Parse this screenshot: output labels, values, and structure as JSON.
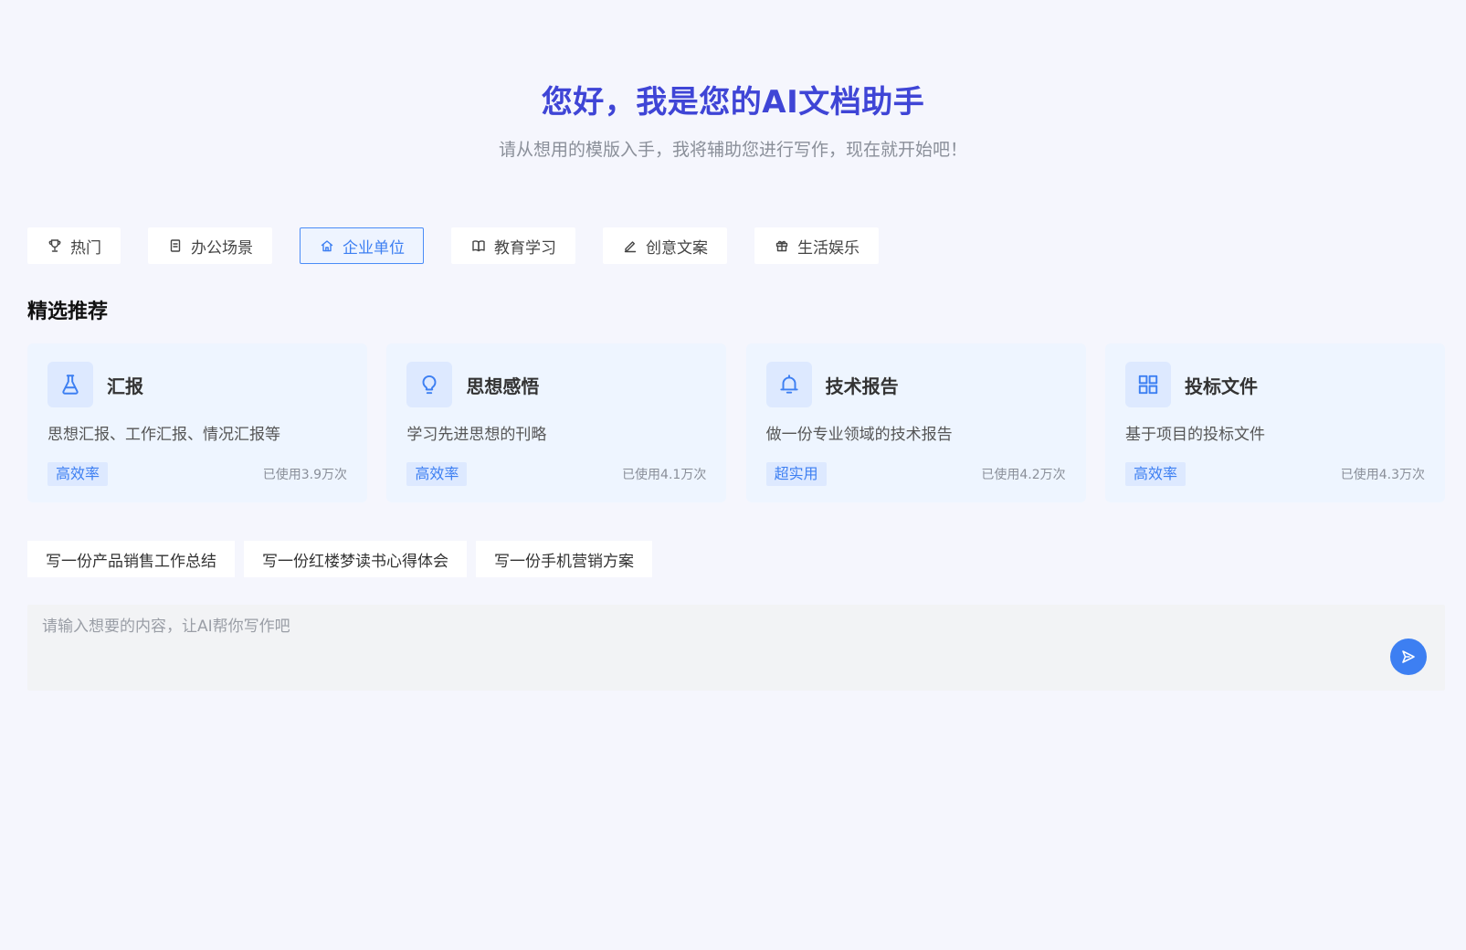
{
  "hero": {
    "title": "您好，我是您的AI文档助手",
    "subtitle": "请从想用的模版入手，我将辅助您进行写作，现在就开始吧！"
  },
  "tabs": [
    {
      "label": "热门",
      "icon": "trophy-icon",
      "active": false
    },
    {
      "label": "办公场景",
      "icon": "document-icon",
      "active": false
    },
    {
      "label": "企业单位",
      "icon": "home-icon",
      "active": true
    },
    {
      "label": "教育学习",
      "icon": "book-icon",
      "active": false
    },
    {
      "label": "创意文案",
      "icon": "pen-icon",
      "active": false
    },
    {
      "label": "生活娱乐",
      "icon": "gift-icon",
      "active": false
    }
  ],
  "section": {
    "title": "精选推荐"
  },
  "cards": [
    {
      "title": "汇报",
      "icon": "flask-icon",
      "desc": "思想汇报、工作汇报、情况汇报等",
      "tag": "高效率",
      "usage": "已使用3.9万次"
    },
    {
      "title": "思想感悟",
      "icon": "lightbulb-icon",
      "desc": "学习先进思想的刊略",
      "tag": "高效率",
      "usage": "已使用4.1万次"
    },
    {
      "title": "技术报告",
      "icon": "bell-icon",
      "desc": "做一份专业领域的技术报告",
      "tag": "超实用",
      "usage": "已使用4.2万次"
    },
    {
      "title": "投标文件",
      "icon": "grid-icon",
      "desc": "基于项目的投标文件",
      "tag": "高效率",
      "usage": "已使用4.3万次"
    }
  ],
  "suggestions": [
    "写一份产品销售工作总结",
    "写一份红楼梦读书心得体会",
    "写一份手机营销方案"
  ],
  "input": {
    "placeholder": "请输入想要的内容，让AI帮你写作吧",
    "value": ""
  },
  "colors": {
    "accent": "#3d7ff2",
    "title": "#3f45d6",
    "background": "#f5f6fd",
    "card_bg": "#eef5ff"
  }
}
